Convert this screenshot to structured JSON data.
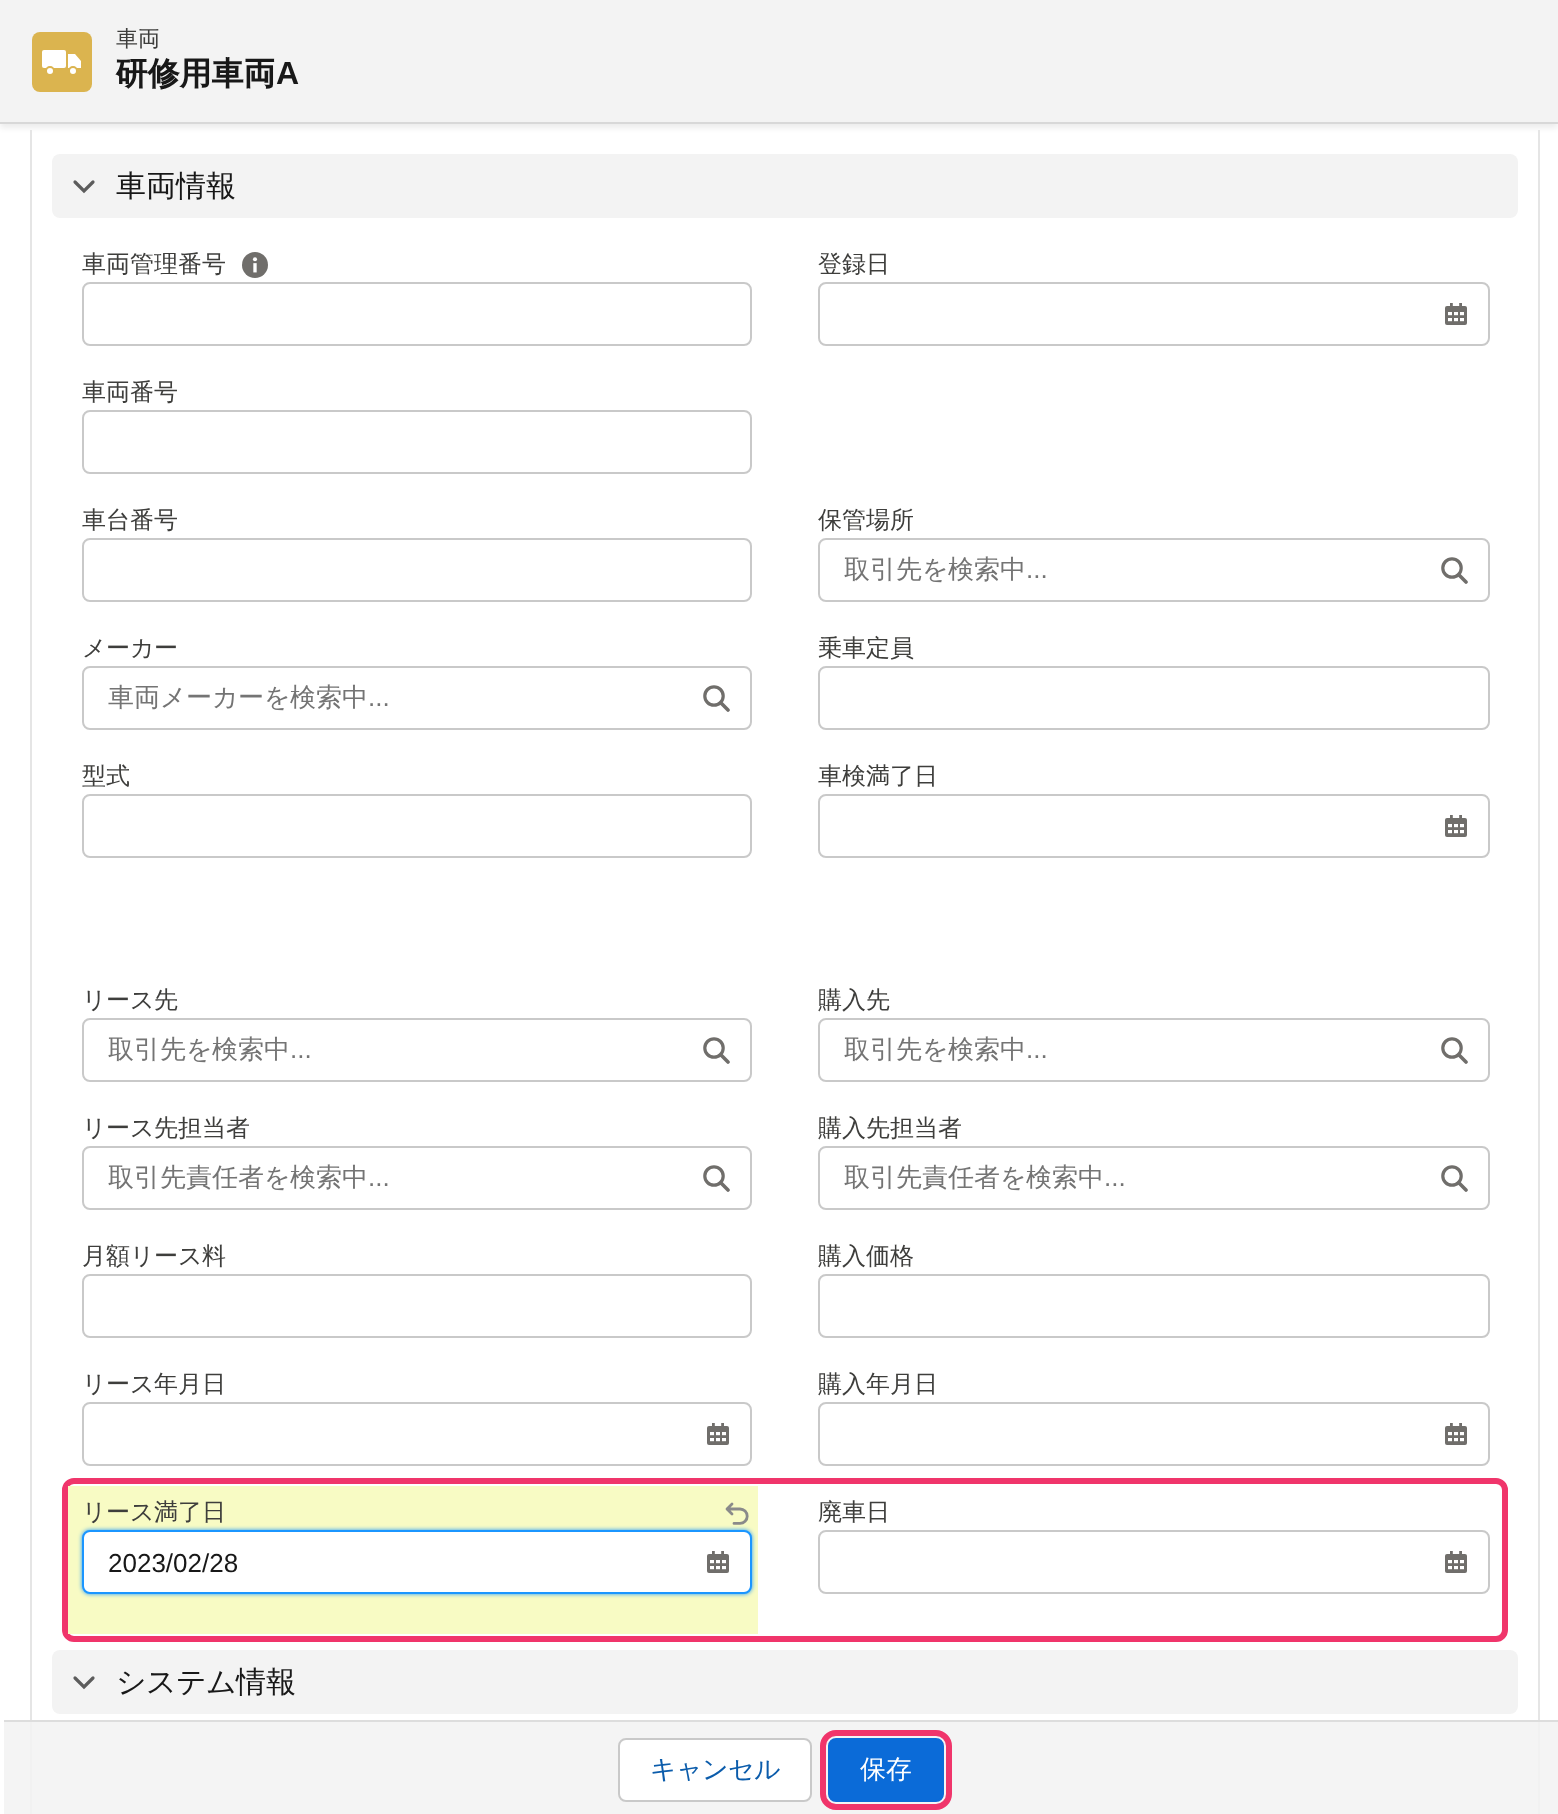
{
  "header": {
    "object_type": "車両",
    "title": "研修用車両A"
  },
  "section": {
    "title": "車両情報",
    "expanded": true
  },
  "field_blocks": [
    [
      {
        "highlighted": false,
        "left": {
          "label": "車両管理番号",
          "kind": "text",
          "info": true,
          "edited": false,
          "focused": false
        },
        "right": {
          "label": "登録日",
          "kind": "date",
          "info": false,
          "edited": false,
          "focused": false
        }
      },
      {
        "highlighted": false,
        "left": {
          "label": "車両番号",
          "kind": "text",
          "info": false,
          "edited": false,
          "focused": false
        }
      },
      {
        "highlighted": false,
        "left": {
          "label": "車台番号",
          "kind": "text",
          "info": false,
          "edited": false,
          "focused": false
        },
        "right": {
          "label": "保管場所",
          "kind": "lookup",
          "placeholder": "取引先を検索中...",
          "info": false,
          "edited": false,
          "focused": false
        }
      },
      {
        "highlighted": false,
        "left": {
          "label": "メーカー",
          "kind": "lookup",
          "placeholder": "車両メーカーを検索中...",
          "info": false,
          "edited": false,
          "focused": false
        },
        "right": {
          "label": "乗車定員",
          "kind": "text",
          "info": false,
          "edited": false,
          "focused": false
        }
      },
      {
        "highlighted": false,
        "left": {
          "label": "型式",
          "kind": "text",
          "info": false,
          "edited": false,
          "focused": false
        },
        "right": {
          "label": "車検満了日",
          "kind": "date",
          "info": false,
          "edited": false,
          "focused": false
        }
      }
    ],
    [
      {
        "highlighted": false,
        "left": {
          "label": "リース先",
          "kind": "lookup",
          "placeholder": "取引先を検索中...",
          "info": false,
          "edited": false,
          "focused": false
        },
        "right": {
          "label": "購入先",
          "kind": "lookup",
          "placeholder": "取引先を検索中...",
          "info": false,
          "edited": false,
          "focused": false
        }
      },
      {
        "highlighted": false,
        "left": {
          "label": "リース先担当者",
          "kind": "lookup",
          "placeholder": "取引先責任者を検索中...",
          "info": false,
          "edited": false,
          "focused": false
        },
        "right": {
          "label": "購入先担当者",
          "kind": "lookup",
          "placeholder": "取引先責任者を検索中...",
          "info": false,
          "edited": false,
          "focused": false
        }
      },
      {
        "highlighted": false,
        "left": {
          "label": "月額リース料",
          "kind": "text",
          "info": false,
          "edited": false,
          "focused": false
        },
        "right": {
          "label": "購入価格",
          "kind": "text",
          "info": false,
          "edited": false,
          "focused": false
        }
      },
      {
        "highlighted": false,
        "left": {
          "label": "リース年月日",
          "kind": "date",
          "info": false,
          "edited": false,
          "focused": false
        },
        "right": {
          "label": "購入年月日",
          "kind": "date",
          "info": false,
          "edited": false,
          "focused": false
        }
      },
      {
        "highlighted": true,
        "left": {
          "label": "リース満了日",
          "kind": "date",
          "value": "2023/02/28",
          "info": false,
          "edited": true,
          "focused": true
        },
        "right": {
          "label": "廃車日",
          "kind": "date",
          "info": false,
          "edited": false,
          "focused": false
        }
      }
    ]
  ],
  "system_section": {
    "title": "システム情報",
    "expanded": true
  },
  "footer": {
    "buttons": [
      {
        "label": "キャンセル",
        "kind": "neutral",
        "highlighted": false
      },
      {
        "label": "保存",
        "kind": "brand",
        "highlighted": true
      }
    ]
  }
}
